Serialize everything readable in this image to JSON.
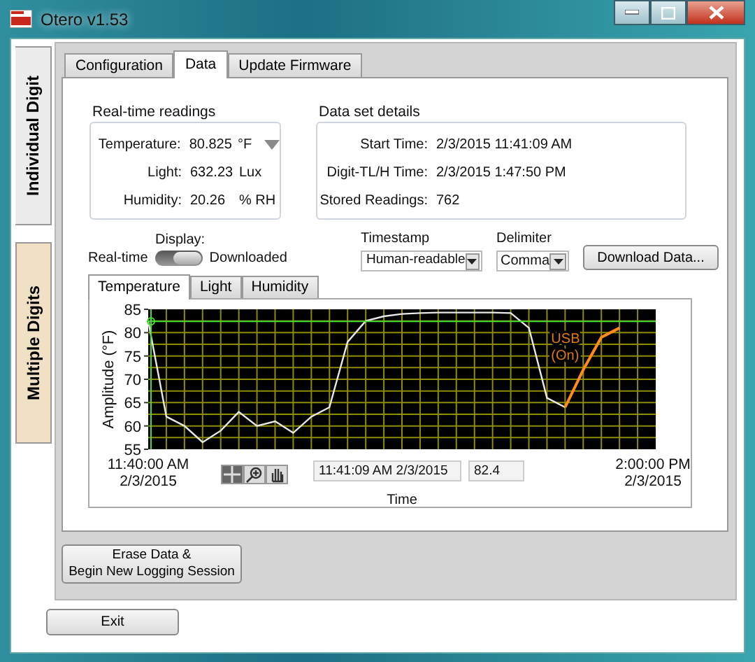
{
  "window": {
    "title": "Otero v1.53"
  },
  "side_tabs": [
    {
      "label": "Individual Digit",
      "selected": true
    },
    {
      "label": "Multiple Digits",
      "selected": false
    }
  ],
  "tabs": [
    {
      "label": "Configuration",
      "selected": false
    },
    {
      "label": "Data",
      "selected": true
    },
    {
      "label": "Update Firmware",
      "selected": false
    }
  ],
  "realtime": {
    "title": "Real-time readings",
    "rows": [
      {
        "label": "Temperature:",
        "value": "80.825",
        "unit": "°F",
        "dropdown": true
      },
      {
        "label": "Light:",
        "value": "632.23",
        "unit": "Lux",
        "dropdown": false
      },
      {
        "label": "Humidity:",
        "value": "20.26",
        "unit": "% RH",
        "dropdown": false
      }
    ]
  },
  "details": {
    "title": "Data set details",
    "rows": [
      {
        "label": "Start Time:",
        "value": "2/3/2015 11:41:09 AM"
      },
      {
        "label": "Digit-TL/H Time:",
        "value": "2/3/2015 1:47:50 PM"
      },
      {
        "label": "Stored Readings:",
        "value": "762"
      }
    ]
  },
  "display": {
    "label": "Display:",
    "options": [
      "Real-time",
      "Downloaded"
    ],
    "on": true
  },
  "timestamp": {
    "label": "Timestamp",
    "value": "Human-readable"
  },
  "delimiter": {
    "label": "Delimiter",
    "value": "Comma"
  },
  "download_button": "Download Data...",
  "graph": {
    "tabs": [
      {
        "label": "Temperature",
        "selected": true
      },
      {
        "label": "Light",
        "selected": false
      },
      {
        "label": "Humidity",
        "selected": false
      }
    ],
    "tools": [
      {
        "kind": "cursor",
        "selected": true
      },
      {
        "kind": "zoom",
        "selected": false
      },
      {
        "kind": "pan",
        "selected": false
      }
    ],
    "cursor": {
      "time": "11:41:09 AM 2/3/2015",
      "value": "82.4"
    },
    "chart_data": {
      "type": "line",
      "xlabel": "Time",
      "ylabel": "Amplitude (°F)",
      "categories": [
        "11:40:00 AM\n2/3/2015",
        null,
        null,
        null,
        null,
        null,
        null,
        null,
        null,
        null,
        null,
        null,
        null,
        null,
        null,
        null,
        null,
        null,
        null,
        null,
        null,
        null,
        null,
        null,
        null,
        null,
        null,
        null,
        "2:00:00 PM\n2/3/2015"
      ],
      "series": [
        {
          "color": "#e8e8e8",
          "values": [
            82.5,
            62,
            60,
            56.5,
            59,
            63,
            60,
            61,
            58.5,
            62,
            64,
            78,
            82.5,
            83.5,
            84,
            84.2,
            84.3,
            84.3,
            84.3,
            84.3,
            84.2,
            81,
            66,
            64,
            null,
            null,
            null,
            null,
            null
          ]
        },
        {
          "color": "#ff8c1a",
          "values": [
            null,
            null,
            null,
            null,
            null,
            null,
            null,
            null,
            null,
            null,
            null,
            null,
            null,
            null,
            null,
            null,
            null,
            null,
            null,
            null,
            null,
            null,
            null,
            64,
            72,
            79,
            81,
            null,
            null
          ]
        }
      ],
      "ylim": [
        55,
        85
      ],
      "yticks": [
        55,
        60,
        65,
        70,
        75,
        80,
        85
      ],
      "grid": true,
      "ref_lines": [
        {
          "axis": "y",
          "value": 82.4
        }
      ],
      "annotations": [
        "USB\n(On)"
      ]
    }
  },
  "erase_button": "Erase Data &\nBegin New Logging Session",
  "exit_button": "Exit"
}
